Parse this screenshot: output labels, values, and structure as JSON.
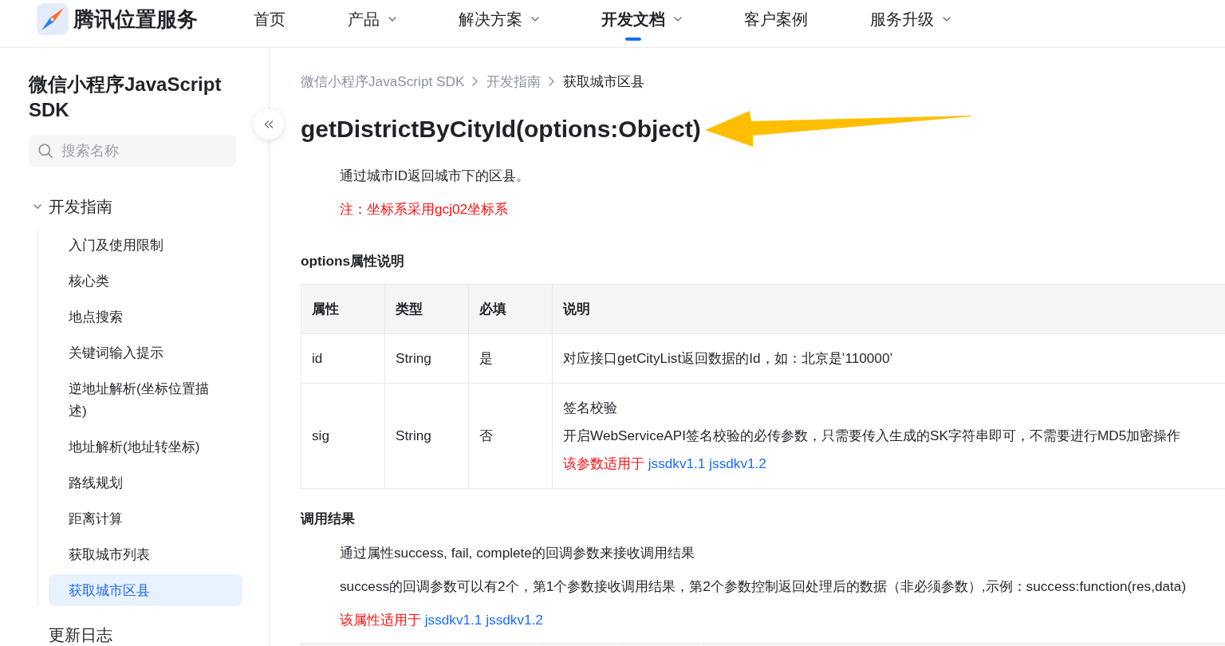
{
  "topnav": {
    "brand": "腾讯位置服务",
    "items": [
      {
        "label": "首页",
        "has_menu": false,
        "selected": false
      },
      {
        "label": "产品",
        "has_menu": true,
        "selected": false
      },
      {
        "label": "解决方案",
        "has_menu": true,
        "selected": false
      },
      {
        "label": "开发文档",
        "has_menu": true,
        "selected": true
      },
      {
        "label": "客户案例",
        "has_menu": false,
        "selected": false
      },
      {
        "label": "服务升级",
        "has_menu": true,
        "selected": false
      }
    ]
  },
  "sidebar": {
    "title": "微信小程序JavaScript SDK",
    "search": {
      "placeholder": "搜索名称"
    },
    "tree": [
      {
        "label": "开发指南",
        "selected": false,
        "expanded": true,
        "children": [
          {
            "label": "入门及使用限制",
            "selected": false
          },
          {
            "label": "核心类",
            "selected": false
          },
          {
            "label": "地点搜索",
            "selected": false
          },
          {
            "label": "关键词输入提示",
            "selected": false
          },
          {
            "label": "逆地址解析(坐标位置描述)",
            "selected": false
          },
          {
            "label": "地址解析(地址转坐标)",
            "selected": false
          },
          {
            "label": "路线规划",
            "selected": false
          },
          {
            "label": "距离计算",
            "selected": false
          },
          {
            "label": "获取城市列表",
            "selected": false
          },
          {
            "label": "获取城市区县",
            "selected": true
          }
        ]
      },
      {
        "label": "更新日志",
        "selected": false
      }
    ]
  },
  "content": {
    "breadcrumb": [
      {
        "label": "微信小程序JavaScript SDK",
        "current": false
      },
      {
        "label": "开发指南",
        "current": false
      },
      {
        "label": "获取城市区县",
        "current": true
      }
    ],
    "title": "getDistrictByCityId(options:Object)",
    "intro": [
      {
        "kind": "text",
        "text": "通过城市ID返回城市下的区县。"
      },
      {
        "kind": "note",
        "text": "注：坐标系采用gcj02坐标系"
      }
    ],
    "sections": [
      {
        "heading": "options属性说明",
        "table": {
          "columns": [
            "属性",
            "类型",
            "必填",
            "说明"
          ],
          "rows": [
            {
              "cells": [
                "id",
                "String",
                "是"
              ],
              "description": [
                {
                  "kind": "text",
                  "text": "对应接口getCityList返回数据的Id，如：北京是’110000’"
                }
              ]
            },
            {
              "cells": [
                "sig",
                "String",
                "否"
              ],
              "description": [
                {
                  "kind": "text",
                  "text": "签名校验"
                },
                {
                  "kind": "text",
                  "text": "开启WebServiceAPI签名校验的必传参数，只需要传入生成的SK字符串即可，不需要进行MD5加密操作"
                },
                {
                  "kind": "compat",
                  "text": "该参数适用于",
                  "links": [
                    "jssdkv1.1",
                    "jssdkv1.2"
                  ]
                }
              ]
            }
          ]
        }
      },
      {
        "heading": "调用结果",
        "paragraphs": [
          {
            "kind": "text",
            "text": "通过属性success, fail, complete的回调参数来接收调用结果"
          },
          {
            "kind": "text",
            "text": "success的回调参数可以有2个，第1个参数接收调用结果，第2个参数控制返回处理后的数据（非必须参数）,示例：success:function(res,data)"
          },
          {
            "kind": "compat",
            "text": "该属性适用于",
            "links": [
              "jssdkv1.1",
              "jssdkv1.2"
            ]
          }
        ]
      }
    ]
  }
}
